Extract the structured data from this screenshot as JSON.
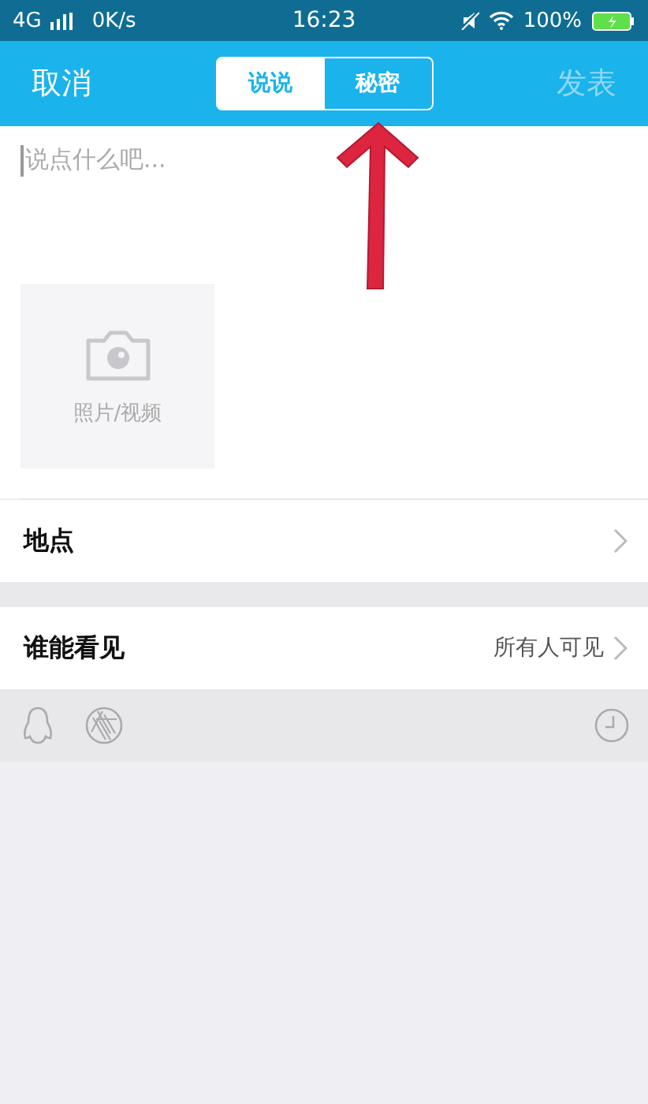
{
  "status_bar": {
    "network": "4G",
    "speed": "0K/s",
    "time": "16:23",
    "battery": "100%"
  },
  "header": {
    "cancel": "取消",
    "publish": {
      "label": "发表",
      "disabled": true
    },
    "tabs": [
      {
        "label": "说说",
        "selected": true
      },
      {
        "label": "秘密",
        "selected": false
      }
    ]
  },
  "composer": {
    "placeholder": "说点什么吧..."
  },
  "media": {
    "label": "照片/视频"
  },
  "rows": [
    {
      "label": "地点"
    },
    {
      "label": "谁能看见",
      "value": "所有人可见"
    }
  ]
}
